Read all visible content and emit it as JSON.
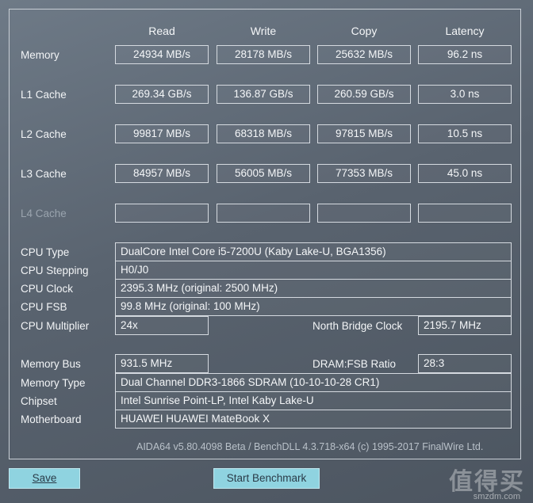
{
  "headers": {
    "read": "Read",
    "write": "Write",
    "copy": "Copy",
    "latency": "Latency"
  },
  "rows": {
    "memory": {
      "label": "Memory",
      "read": "24934 MB/s",
      "write": "28178 MB/s",
      "copy": "25632 MB/s",
      "latency": "96.2 ns"
    },
    "l1": {
      "label": "L1 Cache",
      "read": "269.34 GB/s",
      "write": "136.87 GB/s",
      "copy": "260.59 GB/s",
      "latency": "3.0 ns"
    },
    "l2": {
      "label": "L2 Cache",
      "read": "99817 MB/s",
      "write": "68318 MB/s",
      "copy": "97815 MB/s",
      "latency": "10.5 ns"
    },
    "l3": {
      "label": "L3 Cache",
      "read": "84957 MB/s",
      "write": "56005 MB/s",
      "copy": "77353 MB/s",
      "latency": "45.0 ns"
    },
    "l4": {
      "label": "L4 Cache",
      "read": "",
      "write": "",
      "copy": "",
      "latency": ""
    }
  },
  "info": {
    "cpu_type": {
      "label": "CPU Type",
      "value": "DualCore Intel Core i5-7200U  (Kaby Lake-U, BGA1356)"
    },
    "cpu_stepping": {
      "label": "CPU Stepping",
      "value": "H0/J0"
    },
    "cpu_clock": {
      "label": "CPU Clock",
      "value": "2395.3 MHz  (original: 2500 MHz)"
    },
    "cpu_fsb": {
      "label": "CPU FSB",
      "value": "99.8 MHz  (original: 100 MHz)"
    },
    "cpu_multiplier": {
      "label": "CPU Multiplier",
      "value": "24x"
    },
    "nb_clock": {
      "label": "North Bridge Clock",
      "value": "2195.7 MHz"
    },
    "memory_bus": {
      "label": "Memory Bus",
      "value": "931.5 MHz"
    },
    "dram_ratio": {
      "label": "DRAM:FSB Ratio",
      "value": "28:3"
    },
    "memory_type": {
      "label": "Memory Type",
      "value": "Dual Channel DDR3-1866 SDRAM  (10-10-10-28 CR1)"
    },
    "chipset": {
      "label": "Chipset",
      "value": "Intel Sunrise Point-LP, Intel Kaby Lake-U"
    },
    "motherboard": {
      "label": "Motherboard",
      "value": "HUAWEI HUAWEI MateBook X"
    }
  },
  "footer": "AIDA64 v5.80.4098 Beta / BenchDLL 4.3.718-x64  (c) 1995-2017 FinalWire Ltd.",
  "buttons": {
    "save_label": "Save",
    "benchmark_label": "Start Benchmark"
  },
  "watermark": {
    "main": "值得买",
    "sub": "smzdm.com"
  }
}
